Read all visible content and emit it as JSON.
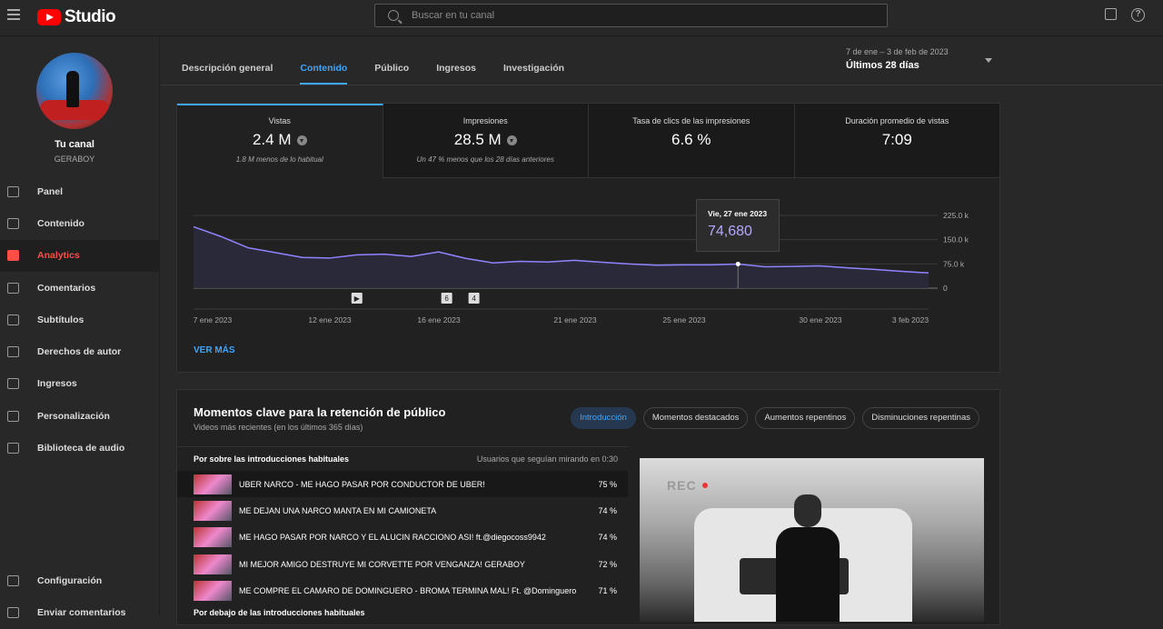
{
  "app": {
    "name": "Studio"
  },
  "search": {
    "placeholder": "Buscar en tu canal"
  },
  "channel": {
    "title": "Tu canal",
    "name": "GERABOY"
  },
  "sidebar": {
    "items": [
      {
        "label": "Panel",
        "icon": "dashboard-icon",
        "active": false
      },
      {
        "label": "Contenido",
        "icon": "content-icon",
        "active": false
      },
      {
        "label": "Analytics",
        "icon": "analytics-icon",
        "active": true
      },
      {
        "label": "Comentarios",
        "icon": "comments-icon",
        "active": false
      },
      {
        "label": "Subtítulos",
        "icon": "subtitles-icon",
        "active": false
      },
      {
        "label": "Derechos de autor",
        "icon": "copyright-icon",
        "active": false
      },
      {
        "label": "Ingresos",
        "icon": "dollar-icon",
        "active": false
      },
      {
        "label": "Personalización",
        "icon": "magic-wand-icon",
        "active": false
      },
      {
        "label": "Biblioteca de audio",
        "icon": "audio-library-icon",
        "active": false
      }
    ],
    "bottom": [
      {
        "label": "Configuración",
        "icon": "gear-icon"
      },
      {
        "label": "Enviar comentarios",
        "icon": "feedback-icon"
      }
    ]
  },
  "tabs": [
    "Descripción general",
    "Contenido",
    "Público",
    "Ingresos",
    "Investigación"
  ],
  "active_tab": "Contenido",
  "daterange": {
    "range": "7 de ene – 3 de feb de 2023",
    "label": "Últimos 28 días"
  },
  "metrics": [
    {
      "label": "Vistas",
      "value": "2.4 M",
      "sub": "1.8 M menos de lo habitual",
      "down": true
    },
    {
      "label": "Impresiones",
      "value": "28.5 M",
      "sub": "Un 47 % menos que los 28 días anteriores",
      "down": true
    },
    {
      "label": "Tasa de clics de las impresiones",
      "value": "6.6 %",
      "sub": "",
      "down": false
    },
    {
      "label": "Duración promedio de vistas",
      "value": "7:09",
      "sub": "",
      "down": false
    }
  ],
  "chart_data": {
    "type": "area",
    "x_ticks": [
      "7 ene 2023",
      "12 ene 2023",
      "16 ene 2023",
      "21 ene 2023",
      "25 ene 2023",
      "30 ene 2023",
      "3 feb 2023"
    ],
    "y_ticks": [
      "225.0 k",
      "150.0 k",
      "75.0 k",
      "0"
    ],
    "ylim": [
      0,
      225000
    ],
    "x": [
      "7 ene",
      "8 ene",
      "9 ene",
      "10 ene",
      "11 ene",
      "12 ene",
      "13 ene",
      "14 ene",
      "15 ene",
      "16 ene",
      "17 ene",
      "18 ene",
      "19 ene",
      "20 ene",
      "21 ene",
      "22 ene",
      "23 ene",
      "24 ene",
      "25 ene",
      "26 ene",
      "27 ene",
      "28 ene",
      "29 ene",
      "30 ene",
      "31 ene",
      "1 feb",
      "2 feb",
      "3 feb"
    ],
    "values": [
      190000,
      160000,
      125000,
      110000,
      95000,
      93000,
      103000,
      105000,
      98000,
      112000,
      92000,
      78000,
      83000,
      81000,
      86000,
      80000,
      75000,
      71000,
      72000,
      72000,
      74680,
      66000,
      67000,
      69000,
      63000,
      58000,
      52000,
      47000
    ],
    "markers": [
      "▶",
      "6",
      "4"
    ],
    "tooltip": {
      "date": "Vie, 27 ene 2023",
      "value": "74,680"
    },
    "color": "#8f84ff"
  },
  "ver_mas": "VER MÁS",
  "retention": {
    "title": "Momentos clave para la retención de público",
    "subtitle": "Videos más recientes (en los últimos 365 días)",
    "pills": [
      "Introducción",
      "Momentos destacados",
      "Aumentos repentinos",
      "Disminuciones repentinas"
    ],
    "above_label": "Por sobre las introducciones habituales",
    "column_label": "Usuarios que seguían mirando en 0:30",
    "rows": [
      {
        "title": "UBER NARCO - ME HAGO PASAR POR CONDUCTOR DE UBER!",
        "pct": "75 %"
      },
      {
        "title": "ME DEJAN UNA NARCO MANTA EN MI CAMIONETA",
        "pct": "74 %"
      },
      {
        "title": "ME HAGO PASAR POR NARCO Y EL ALUCIN RACCIONO ASI! ft.@diegocoss9942",
        "pct": "74 %"
      },
      {
        "title": "MI MEJOR AMIGO DESTRUYE MI CORVETTE POR VENGANZA! GERABOY",
        "pct": "72 %"
      },
      {
        "title": "ME COMPRE EL CAMARO DE DOMINGUERO - BROMA TERMINA MAL! Ft. @Dominguero",
        "pct": "71 %"
      }
    ],
    "below_label": "Por debajo de las introducciones habituales",
    "video_overlay": "REC"
  }
}
